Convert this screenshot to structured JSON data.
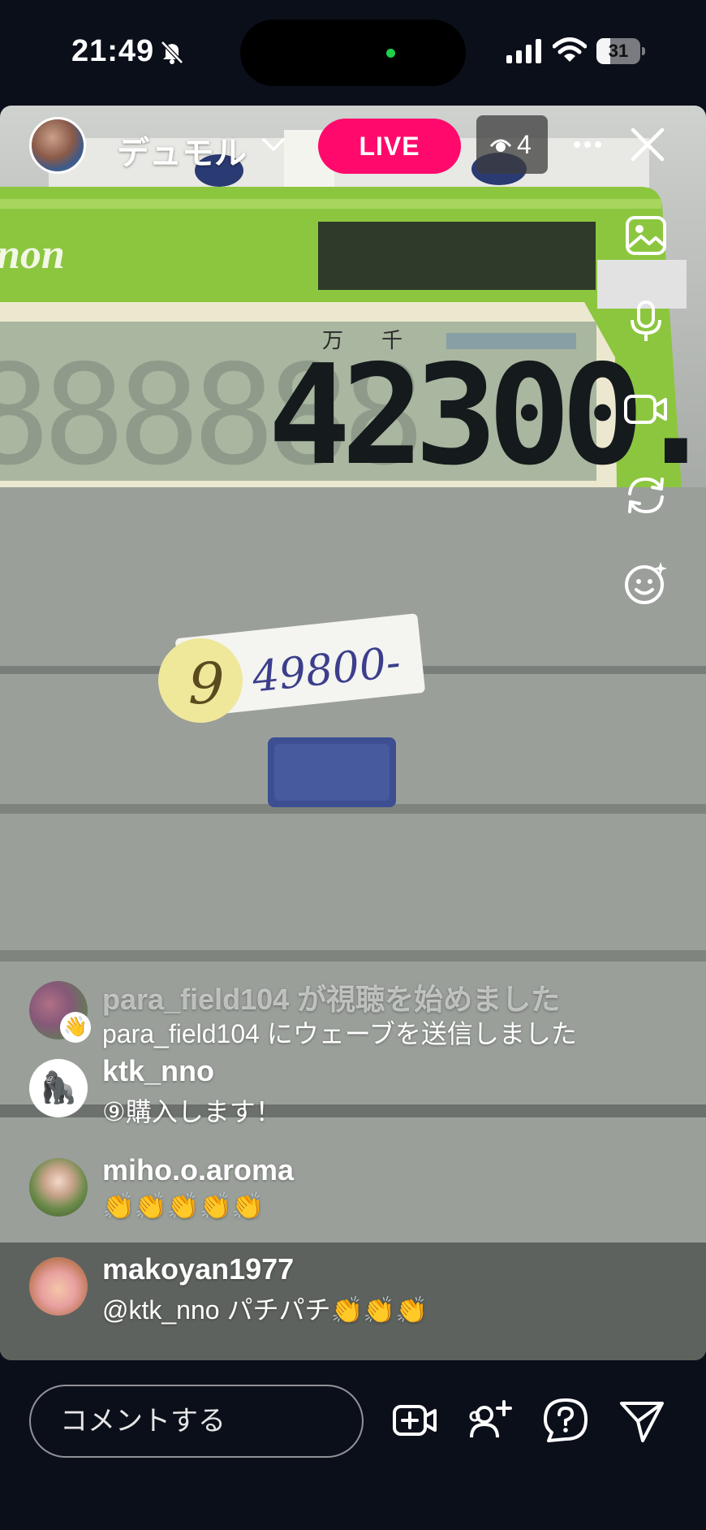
{
  "status_bar": {
    "time": "21:49",
    "battery_level": "31",
    "battery_fraction": 0.31,
    "icons": [
      "bell-slash-icon",
      "cellular-signal-icon",
      "wifi-icon",
      "battery-icon"
    ]
  },
  "live_header": {
    "host_name": "デュモル",
    "live_label": "LIVE",
    "viewer_count": "4",
    "icons": [
      "chevron-down-icon",
      "eye-icon",
      "more-icon",
      "close-icon"
    ]
  },
  "video_scene": {
    "calculator_brand": "anon",
    "calculator_unit_labels": [
      "万",
      "千"
    ],
    "calculator_display": "42300.",
    "price_tag": "49800-",
    "tag_number": "9"
  },
  "side_tools": [
    "image-icon",
    "microphone-icon",
    "camera-icon",
    "flip-camera-icon",
    "face-effects-icon"
  ],
  "comments": [
    {
      "user": "para_field104 が視聴を始めました",
      "text": "para_field104 にウェーブを送信しました",
      "avatar_badge": "👋"
    },
    {
      "user": "ktk_nno",
      "text": "⑨購入します！",
      "avatar_badge": "🦍"
    },
    {
      "user": "miho.o.aroma",
      "text": "👏👏👏👏👏",
      "avatar_badge": ""
    },
    {
      "user": "makoyan1977",
      "text": "@ktk_nno パチパチ👏👏👏",
      "avatar_badge": ""
    }
  ],
  "bottom_bar": {
    "comment_placeholder": "コメントする",
    "icons": [
      "add-video-icon",
      "invite-guest-icon",
      "question-icon",
      "send-icon"
    ]
  },
  "colors": {
    "live_badge": "#ff0a6c",
    "background": "#0b0f1a",
    "calculator_green": "#8cc63f"
  }
}
